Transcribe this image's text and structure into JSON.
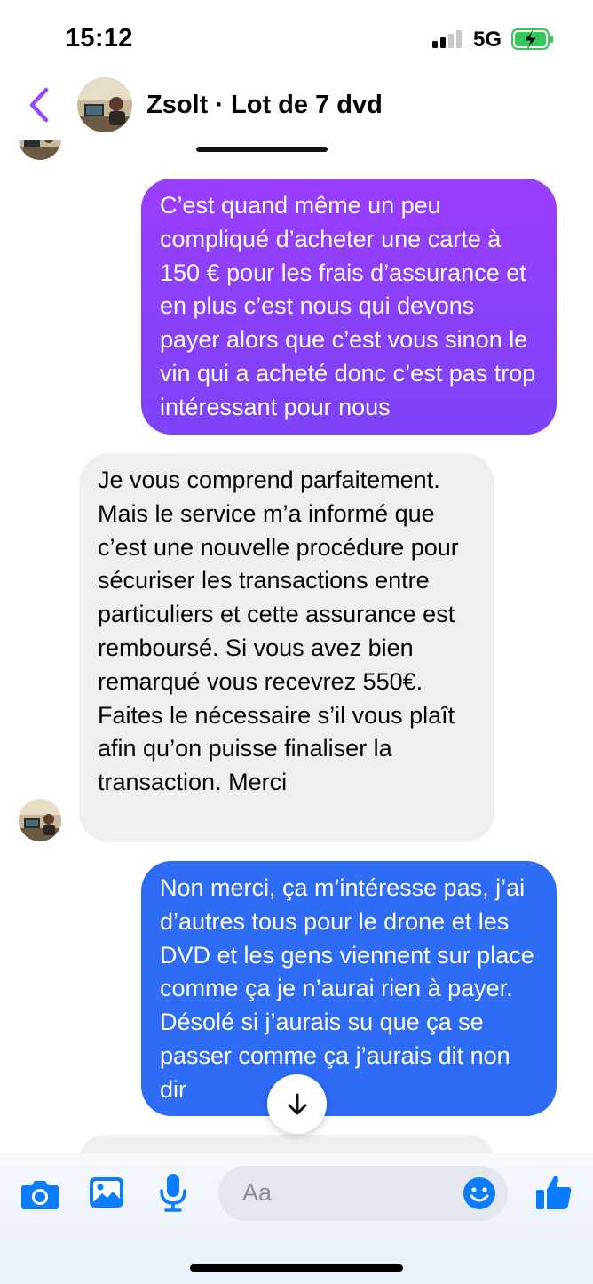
{
  "status": {
    "time": "15:12",
    "network": "5G"
  },
  "header": {
    "title": "Zsolt · Lot de 7 dvd",
    "accent_color": "#9747ff"
  },
  "messages": [
    {
      "direction": "outgoing",
      "text": "C’est quand même un peu compliqué d’acheter une carte à 150 € pour les frais d’assurance et en plus c’est nous qui devons payer alors que c’est vous sinon le vin qui a acheté donc c’est pas trop intéressant pour nous"
    },
    {
      "direction": "incoming",
      "text": "Je vous comprend parfaitement. Mais le service m’a informé que c’est une nouvelle procédure pour sécuriser les transactions entre particuliers et cette assurance est remboursé. Si vous avez bien remarqué vous recevrez 550€. Faites le nécessaire s’il vous plaît afin qu’on puisse finaliser la transaction. Merci"
    },
    {
      "direction": "outgoing",
      "text": "Non merci, ça m’intéresse pas, j’ai d’autres tous pour le drone et les DVD et les gens viennent sur place comme ça je n’aurai rien à payer. Désolé si j’aurais su que ça se passer comme ça j’aurais dit non dir"
    }
  ],
  "composer": {
    "placeholder": "Aa",
    "icons": [
      "camera-icon",
      "gallery-icon",
      "microphone-icon",
      "emoji-icon",
      "thumbs-up-icon"
    ]
  },
  "colors": {
    "outgoing_purple": "#8c3cff",
    "outgoing_blue": "#2f6cf6",
    "icon_blue": "#0a7cff",
    "incoming_bg": "#efefef"
  }
}
